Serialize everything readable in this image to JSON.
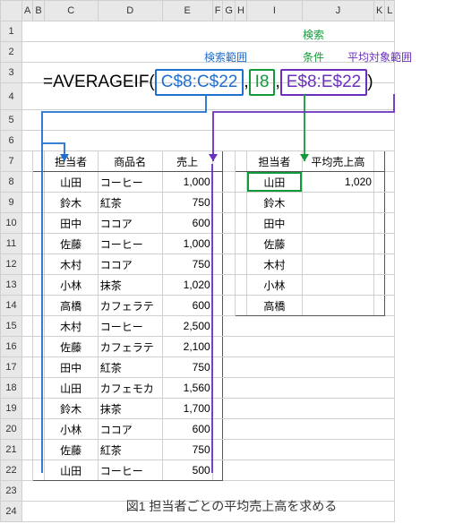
{
  "columns": [
    "A",
    "B",
    "C",
    "D",
    "E",
    "F",
    "G",
    "H",
    "I",
    "J",
    "K",
    "L"
  ],
  "rows": [
    "1",
    "2",
    "3",
    "4",
    "5",
    "6",
    "7",
    "8",
    "9",
    "10",
    "11",
    "12",
    "13",
    "14",
    "15",
    "16",
    "17",
    "18",
    "19",
    "20",
    "21",
    "22",
    "23",
    "24"
  ],
  "labels": {
    "search_range": "検索範囲",
    "search_cond": "検索",
    "search_cond2": "条件",
    "avg_range": "平均対象範囲"
  },
  "formula": {
    "eq": "=AVERAGEIF(",
    "arg1": "C$8:C$22",
    "comma": ",",
    "arg2": "I8",
    "arg3": "E$8:E$22",
    "close": ")"
  },
  "table1": {
    "headers": {
      "c": "担当者",
      "d": "商品名",
      "e": "売上"
    },
    "rows": [
      {
        "c": "山田",
        "d": "コーヒー",
        "e": "1,000"
      },
      {
        "c": "鈴木",
        "d": "紅茶",
        "e": "750"
      },
      {
        "c": "田中",
        "d": "ココア",
        "e": "600"
      },
      {
        "c": "佐藤",
        "d": "コーヒー",
        "e": "1,000"
      },
      {
        "c": "木村",
        "d": "ココア",
        "e": "750"
      },
      {
        "c": "小林",
        "d": "抹茶",
        "e": "1,020"
      },
      {
        "c": "高橋",
        "d": "カフェラテ",
        "e": "600"
      },
      {
        "c": "木村",
        "d": "コーヒー",
        "e": "2,500"
      },
      {
        "c": "佐藤",
        "d": "カフェラテ",
        "e": "2,100"
      },
      {
        "c": "田中",
        "d": "紅茶",
        "e": "750"
      },
      {
        "c": "山田",
        "d": "カフェモカ",
        "e": "1,560"
      },
      {
        "c": "鈴木",
        "d": "抹茶",
        "e": "1,700"
      },
      {
        "c": "小林",
        "d": "ココア",
        "e": "600"
      },
      {
        "c": "佐藤",
        "d": "紅茶",
        "e": "750"
      },
      {
        "c": "山田",
        "d": "コーヒー",
        "e": "500"
      }
    ]
  },
  "table2": {
    "headers": {
      "i": "担当者",
      "j": "平均売上高"
    },
    "rows": [
      {
        "i": "山田",
        "j": "1,020"
      },
      {
        "i": "鈴木",
        "j": ""
      },
      {
        "i": "田中",
        "j": ""
      },
      {
        "i": "佐藤",
        "j": ""
      },
      {
        "i": "木村",
        "j": ""
      },
      {
        "i": "小林",
        "j": ""
      },
      {
        "i": "高橋",
        "j": ""
      }
    ]
  },
  "caption": "図1 担当者ごとの平均売上高を求める"
}
